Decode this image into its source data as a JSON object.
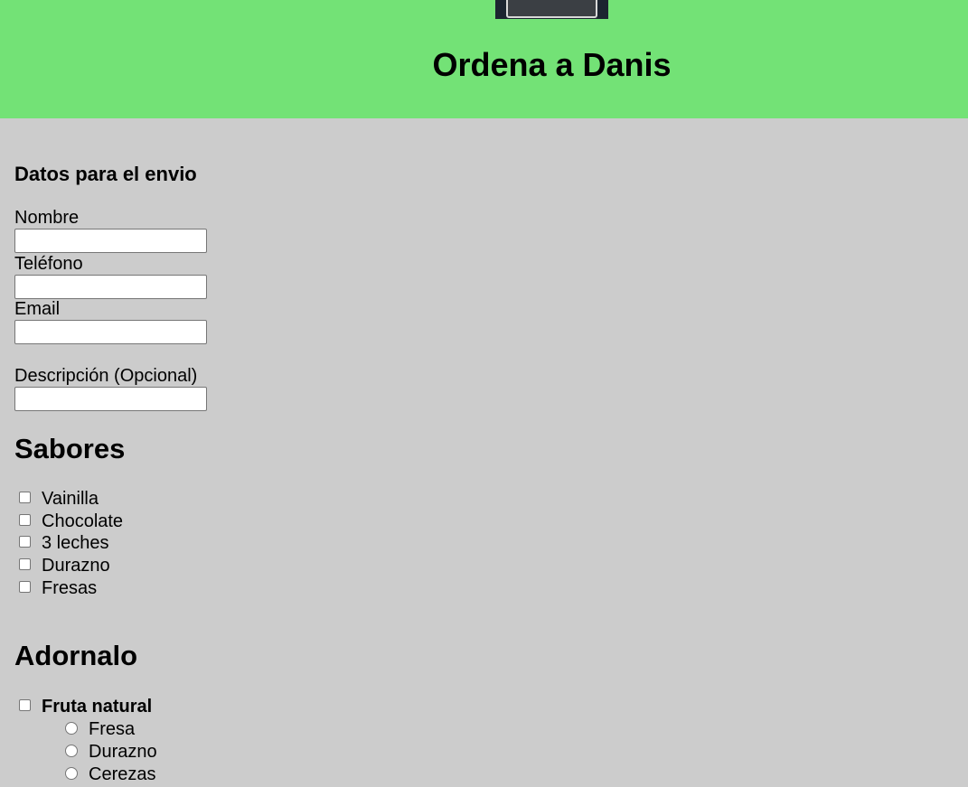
{
  "header": {
    "title": "Ordena a Danis",
    "background": "#73e276"
  },
  "form": {
    "shipping_heading": "Datos para el envio",
    "fields": [
      {
        "label": "Nombre",
        "value": "",
        "placeholder": ""
      },
      {
        "label": "Teléfono",
        "value": "",
        "placeholder": ""
      },
      {
        "label": "Email",
        "value": "",
        "placeholder": ""
      },
      {
        "label": "Descripción (Opcional)",
        "value": "",
        "placeholder": ""
      }
    ]
  },
  "flavors": {
    "heading": "Sabores",
    "options": [
      "Vainilla",
      "Chocolate",
      "3 leches",
      "Durazno",
      "Fresas"
    ]
  },
  "decorations": {
    "heading": "Adornalo",
    "group_label": "Fruta natural",
    "fruit_options": [
      "Fresa",
      "Durazno",
      "Cerezas"
    ]
  },
  "colors": {
    "page_background": "#cccccc",
    "header_background": "#73e276"
  }
}
